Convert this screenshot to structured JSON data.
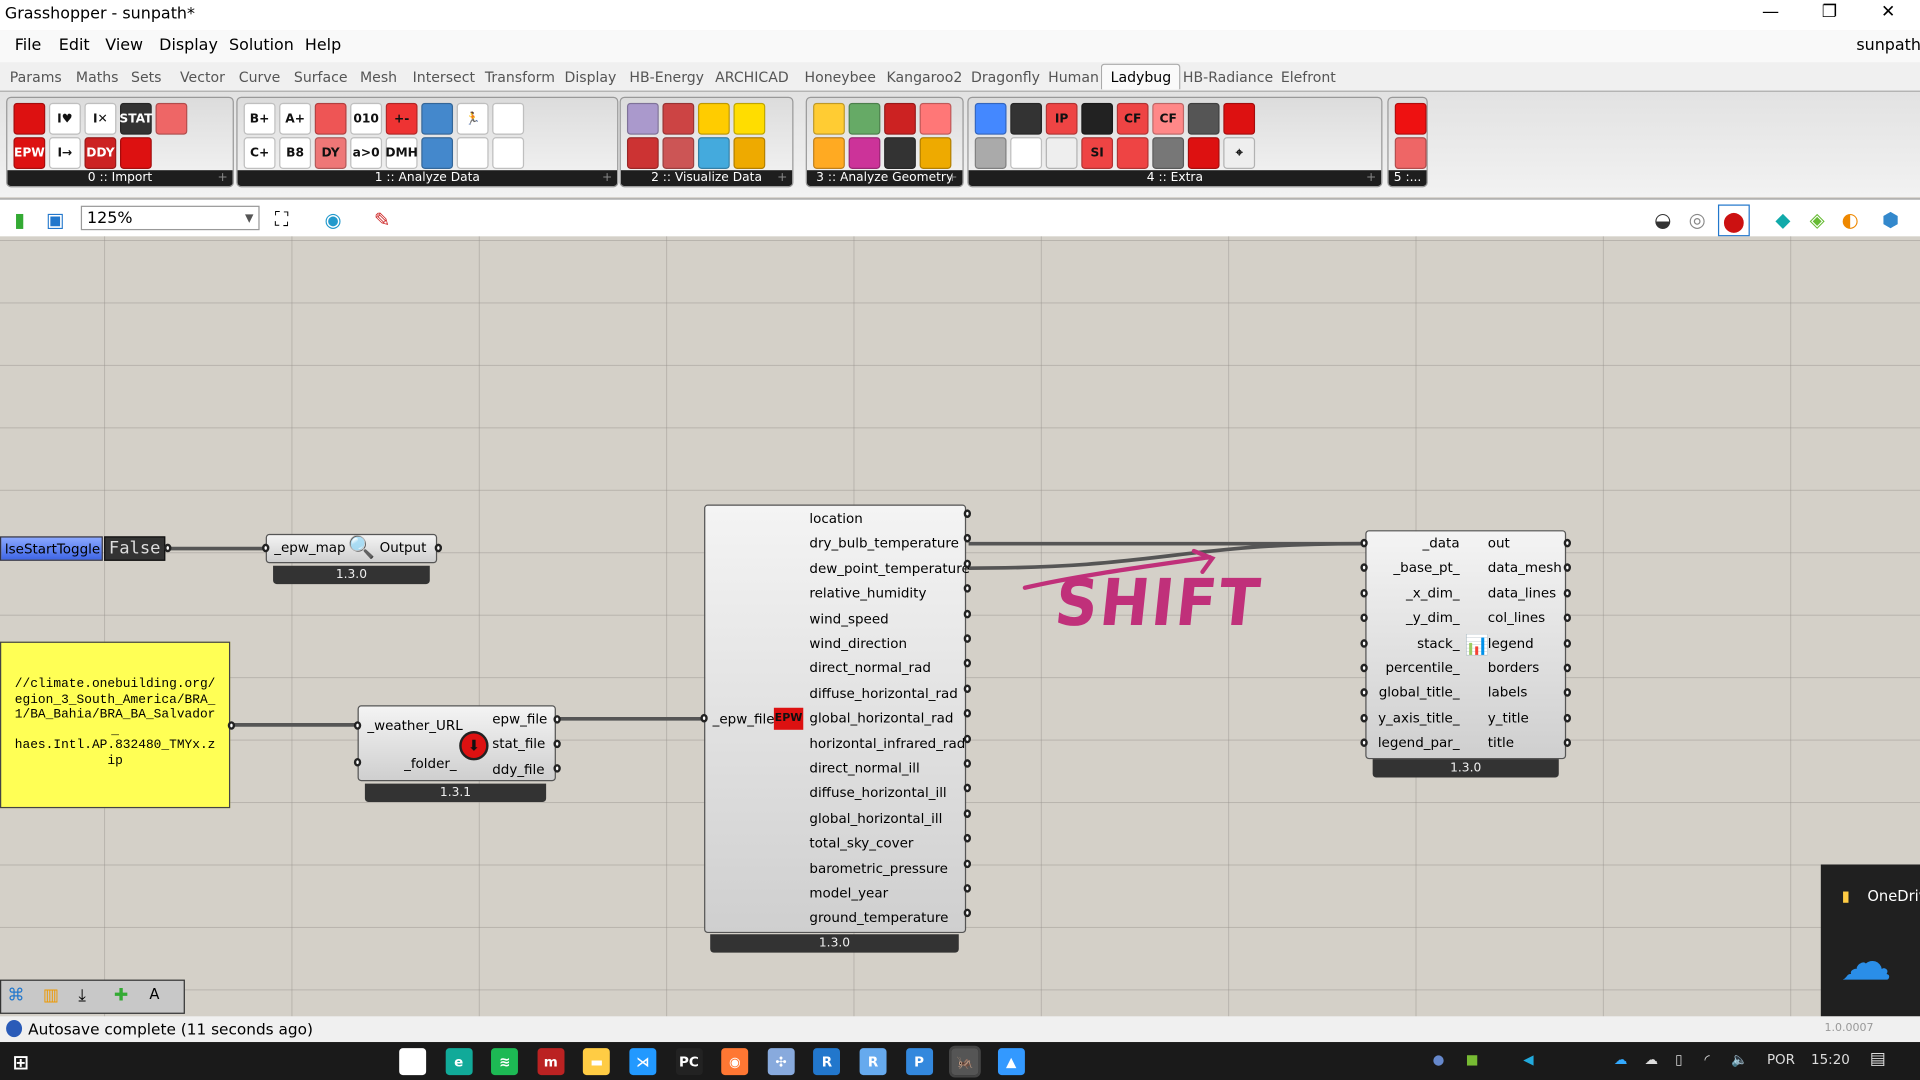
{
  "window": {
    "title": "Grasshopper - sunpath*",
    "doc_name": "sunpath",
    "minimize": "—",
    "restore": "❐",
    "close": "✕"
  },
  "menu": [
    "File",
    "Edit",
    "View",
    "Display",
    "Solution",
    "Help"
  ],
  "tabs": [
    "Params",
    "Maths",
    "Sets",
    "Vector",
    "Curve",
    "Surface",
    "Mesh",
    "Intersect",
    "Transform",
    "Display",
    "HB-Energy",
    "ARCHICAD",
    "Honeybee",
    "Kangaroo2",
    "Dragonfly",
    "Human",
    "Ladybug",
    "HB-Radiance",
    "Elefront"
  ],
  "active_tab": "Ladybug",
  "ribbon_groups": [
    {
      "label": "0 :: Import",
      "icons": [
        [
          "download-weather",
          "#d11"
        ],
        [
          "open-epw",
          "#d11",
          "EPW"
        ],
        [
          "import-location",
          "#fff",
          "I♥"
        ],
        [
          "import-stat",
          "#fff",
          "I→"
        ],
        [
          "import-dd",
          "#fff",
          "I✕"
        ],
        [
          "ddy",
          "#c22",
          "DDY"
        ],
        [
          "stat",
          "#333",
          "STAT"
        ],
        [
          "wea-from-epw",
          "#d11"
        ],
        [
          "epw-map",
          "#e66"
        ]
      ]
    },
    {
      "label": "1 :: Analyze Data",
      "icons": [
        [
          "apply-analysis-period",
          "#fff",
          "B+"
        ],
        [
          "apply-condition",
          "#fff",
          "C+"
        ],
        [
          "time-interval",
          "#fff",
          "A+"
        ],
        [
          "arithmetic",
          "#fff",
          "B8"
        ],
        [
          "orient",
          "#e55"
        ],
        [
          "dy",
          "#e77",
          "DY"
        ],
        [
          "binary",
          "#fff",
          "010"
        ],
        [
          "conditional",
          "#fff",
          "a>0"
        ],
        [
          "calc",
          "#e33",
          "+-"
        ],
        [
          "dmh",
          "#fff",
          "DMH"
        ],
        [
          "humidity",
          "#48c"
        ],
        [
          "utci",
          "#48c"
        ],
        [
          "pmv",
          "#fff",
          "🏃"
        ],
        [
          "pmv2",
          "#fff"
        ],
        [
          "comfort",
          "#fff"
        ],
        [
          "adaptive",
          "#fff"
        ]
      ]
    },
    {
      "label": "2 :: Visualize Data",
      "icons": [
        [
          "hourly-plot",
          "#a9c"
        ],
        [
          "monthly-chart",
          "#c33"
        ],
        [
          "psych",
          "#c44"
        ],
        [
          "bar-chart",
          "#c55"
        ],
        [
          "sunpath",
          "#fc0"
        ],
        [
          "wind-rose",
          "#4ad"
        ],
        [
          "sky-dome",
          "#fd0"
        ],
        [
          "radiation-rose",
          "#ea0"
        ]
      ]
    },
    {
      "label": "3 :: Analyze Geometry",
      "icons": [
        [
          "sun-analysis",
          "#fc3"
        ],
        [
          "radiation",
          "#fa2"
        ],
        [
          "view-percent",
          "#6a6"
        ],
        [
          "visibility",
          "#c39"
        ],
        [
          "human-to-sky",
          "#c22"
        ],
        [
          "glare",
          "#333"
        ],
        [
          "shade",
          "#f77"
        ],
        [
          "sun-rays",
          "#ea0"
        ]
      ]
    },
    {
      "label": "4 :: Extra",
      "icons": [
        [
          "color-range",
          "#48f"
        ],
        [
          "legend-param",
          "#aaa"
        ],
        [
          "gradient-dots",
          "#333"
        ],
        [
          "image-legend",
          "#fff"
        ],
        [
          "ip-text",
          "#e44",
          "IP"
        ],
        [
          "view-capture",
          "#eee"
        ],
        [
          "capture",
          "#222"
        ],
        [
          "si-ip",
          "#e44",
          "SI"
        ],
        [
          "c-f",
          "#e44",
          "CF"
        ],
        [
          "si-ip2",
          "#e44"
        ],
        [
          "si",
          "#f88",
          "CF"
        ],
        [
          "mannequin",
          "#777"
        ],
        [
          "people",
          "#555"
        ],
        [
          "folder",
          "#d11"
        ],
        [
          "open-folder",
          "#d11"
        ],
        [
          "crosshair",
          "#eee",
          "⌖"
        ]
      ]
    },
    {
      "label": "5 :...",
      "icons": [
        [
          "record",
          "#e11"
        ],
        [
          "record-half",
          "#e66"
        ]
      ]
    }
  ],
  "toolbar": {
    "zoom": "125%"
  },
  "canvas": {
    "toggle": {
      "name": "lseStartToggle",
      "value": "False"
    },
    "panel": {
      "text": "//climate.onebuilding.org/\negion_3_South_America/BRA_\n1/BA_Bahia/BRA_BA_Salvador\n_\nhaes.Intl.AP.832480_TMYx.z\nip"
    },
    "epw_map": {
      "input": "_epw_map",
      "output": "Output",
      "version": "1.3.0"
    },
    "download": {
      "inputs": [
        "_weather_URL",
        "_folder_"
      ],
      "outputs": [
        "epw_file",
        "stat_file",
        "ddy_file"
      ],
      "version": "1.3.1"
    },
    "import_epw": {
      "input": "_epw_file",
      "icon_text": "EPW",
      "outputs": [
        "location",
        "dry_bulb_temperature",
        "dew_point_temperature",
        "relative_humidity",
        "wind_speed",
        "wind_direction",
        "direct_normal_rad",
        "diffuse_horizontal_rad",
        "global_horizontal_rad",
        "horizontal_infrared_rad",
        "direct_normal_ill",
        "diffuse_horizontal_ill",
        "global_horizontal_ill",
        "total_sky_cover",
        "barometric_pressure",
        "model_year",
        "ground_temperature"
      ],
      "version": "1.3.0"
    },
    "monthly_chart": {
      "inputs": [
        "_data",
        "_base_pt_",
        "_x_dim_",
        "_y_dim_",
        "stack_",
        "percentile_",
        "global_title_",
        "y_axis_title_",
        "legend_par_"
      ],
      "outputs": [
        "out",
        "data_mesh",
        "data_lines",
        "col_lines",
        "legend",
        "borders",
        "labels",
        "y_title",
        "title"
      ],
      "version": "1.3.0"
    },
    "annotation": {
      "text": "SHIFT",
      "color": "#c0307a"
    }
  },
  "canvas_tools": [
    "python",
    "gh-script",
    "import",
    "cluster",
    "font"
  ],
  "onedrive": {
    "label": "OneDriv"
  },
  "status": {
    "message": "Autosave complete (11 seconds ago)",
    "version": "1.0.0007"
  },
  "taskbar": {
    "apps": [
      [
        "store",
        "#fff",
        "▦"
      ],
      [
        "edge",
        "#1a9",
        "e"
      ],
      [
        "spotify",
        "#1db954",
        "≋"
      ],
      [
        "app-m",
        "#b22",
        "m"
      ],
      [
        "file-explorer",
        "#fc4",
        "▬"
      ],
      [
        "vscode",
        "#29f",
        "⋊"
      ],
      [
        "pycharm",
        "#222",
        "PC"
      ],
      [
        "firefox",
        "#f73",
        "◉"
      ],
      [
        "slack",
        "#8ad",
        "✣"
      ],
      [
        "r-app",
        "#27c",
        "R"
      ],
      [
        "r-studio",
        "#6ae",
        "R"
      ],
      [
        "photoshop",
        "#38d",
        "P"
      ],
      [
        "rhino",
        "#555",
        "🦗"
      ],
      [
        "photos",
        "#39f",
        "▲"
      ]
    ],
    "lang": "POR",
    "time": "15:20"
  }
}
